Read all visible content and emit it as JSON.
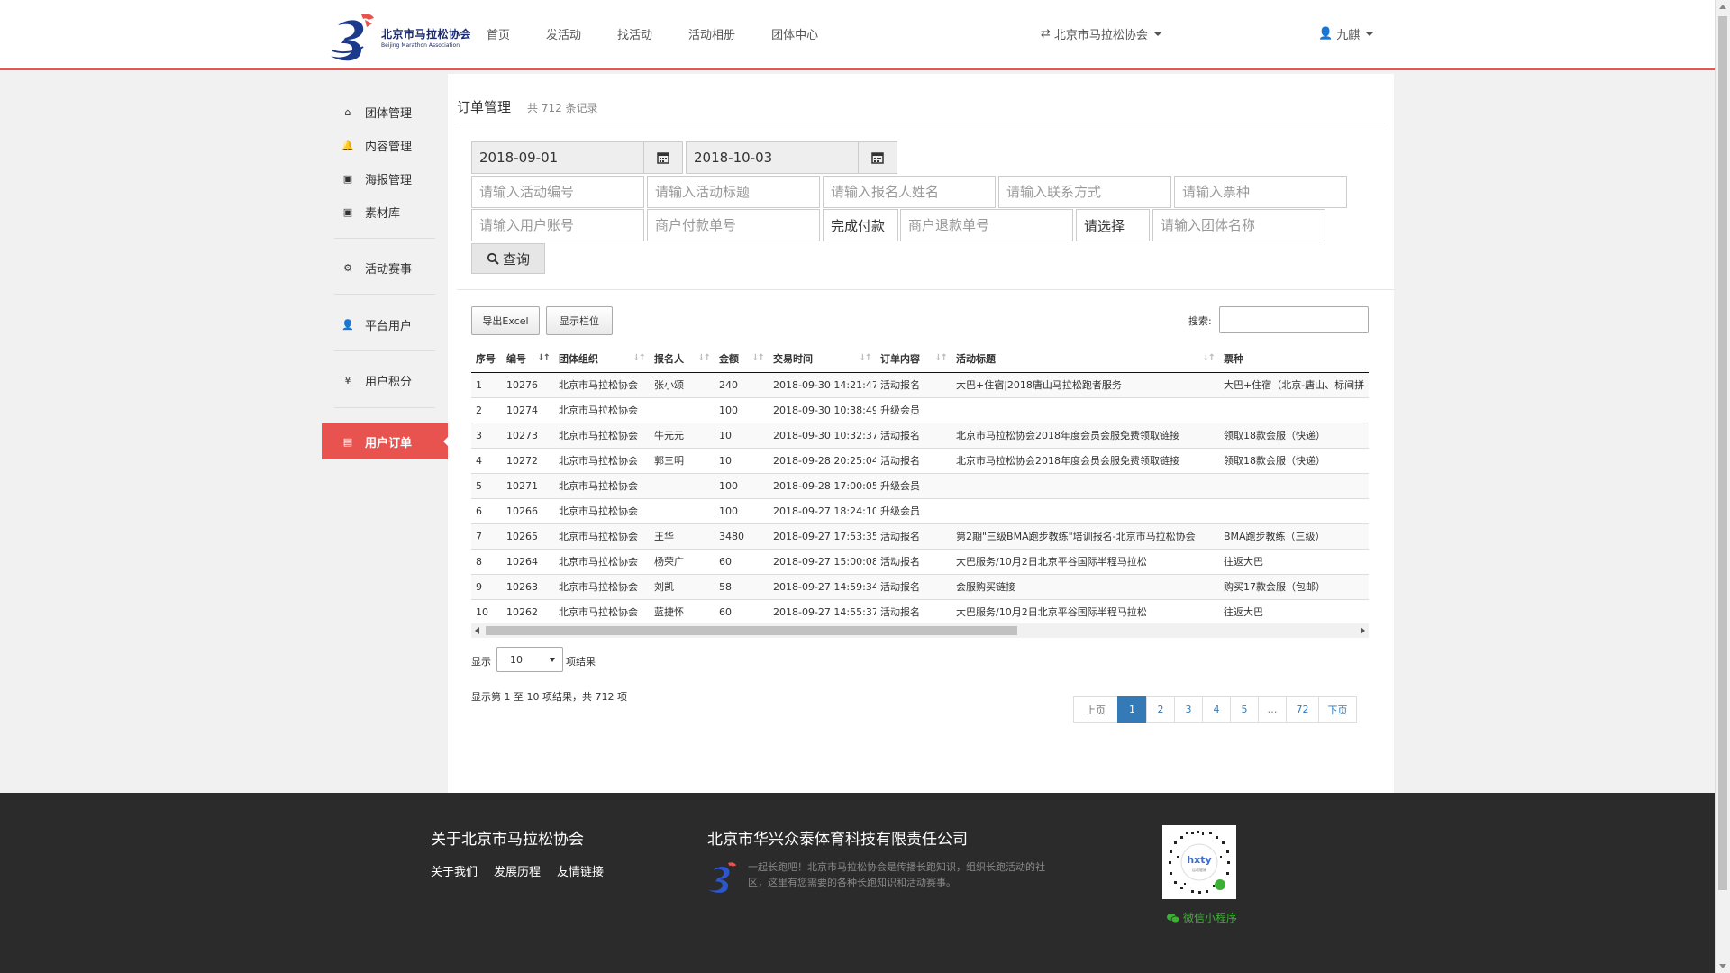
{
  "logo": {
    "cn": "北京市马拉松协会",
    "en": "Beijing Marathon Association"
  },
  "nav": [
    "首页",
    "发活动",
    "找活动",
    "活动相册",
    "团体中心"
  ],
  "org_switch": "北京市马拉松协会",
  "user": "九麒",
  "sidebar": [
    {
      "label": "团体管理",
      "icon": "home-icon",
      "glyph": "⌂"
    },
    {
      "label": "内容管理",
      "icon": "bell-icon",
      "glyph": "🔔"
    },
    {
      "label": "海报管理",
      "icon": "image-icon",
      "glyph": "▣"
    },
    {
      "label": "素材库",
      "icon": "image-icon",
      "glyph": "▣"
    },
    {
      "label": "活动赛事",
      "icon": "gear-icon",
      "glyph": "⚙"
    },
    {
      "label": "平台用户",
      "icon": "user-icon",
      "glyph": "👤"
    },
    {
      "label": "用户积分",
      "icon": "yen-icon",
      "glyph": "¥"
    },
    {
      "label": "用户订单",
      "icon": "file-icon",
      "glyph": "▤",
      "active": true
    }
  ],
  "page": {
    "title": "订单管理",
    "count": "共 712 条记录"
  },
  "filters": {
    "date_start": "2018-09-01",
    "date_end": "2018-10-03",
    "activity_no": "请输入活动编号",
    "activity_title": "请输入活动标题",
    "signup_name": "请输入报名人姓名",
    "contact": "请输入联系方式",
    "ticket": "请输入票种",
    "user_account": "请输入用户账号",
    "merchant_pay_no": "商户付款单号",
    "pay_status": "完成付款",
    "merchant_refund_no": "商户退款单号",
    "select_placeholder": "请选择",
    "group_name": "请输入团体名称",
    "query_label": "查询"
  },
  "toolbar": {
    "export_label": "导出Excel",
    "columns_label": "显示栏位",
    "search_label": "搜索:"
  },
  "table": {
    "headers": [
      "序号",
      "编号",
      "团体组织",
      "报名人",
      "金额",
      "交易时间",
      "订单内容",
      "活动标题",
      "票种"
    ],
    "rows": [
      [
        "1",
        "10276",
        "北京市马拉松协会",
        "张小颂",
        "240",
        "2018-09-30 14:21:47",
        "活动报名",
        "大巴+住宿|2018唐山马拉松跑者服务",
        "大巴+住宿（北京-唐山、标间拼"
      ],
      [
        "2",
        "10274",
        "北京市马拉松协会",
        "",
        "100",
        "2018-09-30 10:38:49",
        "升级会员",
        "",
        ""
      ],
      [
        "3",
        "10273",
        "北京市马拉松协会",
        "牛元元",
        "10",
        "2018-09-30 10:32:37",
        "活动报名",
        "北京市马拉松协会2018年度会员会服免费领取链接",
        "领取18款会服（快递）"
      ],
      [
        "4",
        "10272",
        "北京市马拉松协会",
        "郭三明",
        "10",
        "2018-09-28 20:25:04",
        "活动报名",
        "北京市马拉松协会2018年度会员会服免费领取链接",
        "领取18款会服（快递）"
      ],
      [
        "5",
        "10271",
        "北京市马拉松协会",
        "",
        "100",
        "2018-09-28 17:00:05",
        "升级会员",
        "",
        ""
      ],
      [
        "6",
        "10266",
        "北京市马拉松协会",
        "",
        "100",
        "2018-09-27 18:24:10",
        "升级会员",
        "",
        ""
      ],
      [
        "7",
        "10265",
        "北京市马拉松协会",
        "王华",
        "3480",
        "2018-09-27 17:53:35",
        "活动报名",
        "第2期\"三级BMA跑步教练\"培训报名-北京市马拉松协会",
        "BMA跑步教练（三级）"
      ],
      [
        "8",
        "10264",
        "北京市马拉松协会",
        "杨荣广",
        "60",
        "2018-09-27 15:00:08",
        "活动报名",
        "大巴服务/10月2日北京平谷国际半程马拉松",
        "往返大巴"
      ],
      [
        "9",
        "10263",
        "北京市马拉松协会",
        "刘凯",
        "58",
        "2018-09-27 14:59:34",
        "活动报名",
        "会服购买链接",
        "购买17款会服（包邮）"
      ],
      [
        "10",
        "10262",
        "北京市马拉松协会",
        "蓝捷怀",
        "60",
        "2018-09-27 14:55:37",
        "活动报名",
        "大巴服务/10月2日北京平谷国际半程马拉松",
        "往返大巴"
      ]
    ]
  },
  "length": {
    "label": "显示",
    "value": "10",
    "suffix": "项结果"
  },
  "info": "显示第 1 至 10 项结果，共 712 项",
  "pager": {
    "prev": "上页",
    "pages": [
      "1",
      "2",
      "3",
      "4",
      "5",
      "…",
      "72"
    ],
    "next": "下页",
    "active": "1"
  },
  "footer": {
    "about_title": "关于北京市马拉松协会",
    "links": [
      "关于我们",
      "发展历程",
      "友情链接"
    ],
    "company": "北京市华兴众泰体育科技有限责任公司",
    "desc": "一起长跑吧！北京市马拉松协会是传播长跑知识，组织长跑活动的社区，这里有您需要的各种长跑知识和活动赛事。",
    "wechat": "微信小程序"
  },
  "colors": {
    "accent": "#e8534f",
    "link": "#337ab7",
    "footer_bg": "#2b2b2b",
    "wechat": "#3cb034"
  }
}
